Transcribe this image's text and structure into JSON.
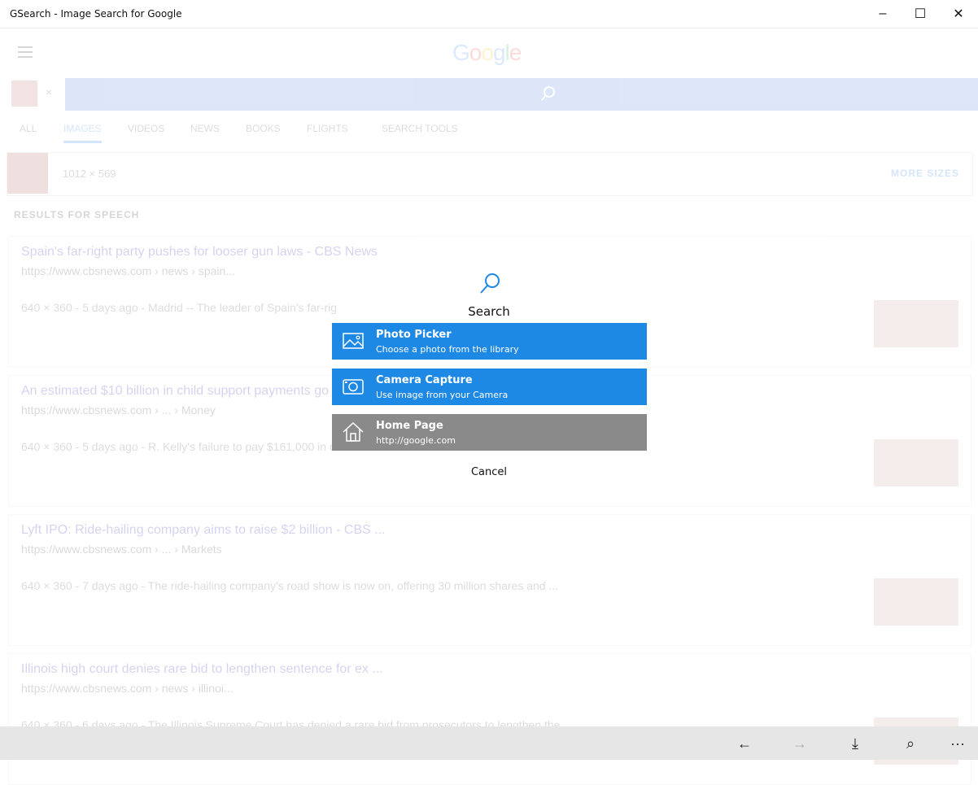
{
  "window": {
    "title": "GSearch - Image Search for Google",
    "min": "–",
    "max": "☐",
    "close": "✕"
  },
  "app": {
    "logo": {
      "G": "G",
      "o1": "o",
      "o2": "o",
      "g": "g",
      "l": "l",
      "e": "e"
    },
    "search_chip_close": "×",
    "tabs": [
      "ALL",
      "IMAGES",
      "VIDEOS",
      "NEWS",
      "BOOKS",
      "FLIGHTS",
      "SEARCH TOOLS"
    ],
    "active_tab": "IMAGES",
    "size_bar": {
      "dims": "1012 × 569",
      "more": "MORE SIZES"
    },
    "results_label": "RESULTS FOR SPEECH",
    "results": [
      {
        "title": "Spain's far-right party pushes for looser gun laws - CBS News",
        "url": "https://www.cbsnews.com › news › spain...",
        "desc": "640 × 360 - 5 days ago - Madrid -- The leader of Spain's far-rig"
      },
      {
        "title": "An estimated $10 billion in child support payments go",
        "url": "https://www.cbsnews.com › ... › Money",
        "desc": "640 × 360 - 5 days ago - R. Kelly's failure to pay $161,000 in c"
      },
      {
        "title": "Lyft IPO: Ride-hailing company aims to raise $2 billion - CBS ...",
        "url": "https://www.cbsnews.com › ... › Markets",
        "desc": "640 × 360 - 7 days ago - The ride-hailing company's road show is now on, offering 30 million shares and ..."
      },
      {
        "title": "Illinois high court denies rare bid to lengthen sentence for ex ...",
        "url": "https://www.cbsnews.com › news › illinoi...",
        "desc": "640 × 360 - 6 days ago - The Illinois Supreme Court has denied a rare bid from prosecutors to lengthen the ..."
      }
    ]
  },
  "dialog": {
    "title": "Search",
    "icon": "search-icon",
    "options": [
      {
        "title": "Photo Picker",
        "subtitle": "Choose a photo from the library",
        "icon": "image-icon",
        "color": "#1e88e5"
      },
      {
        "title": "Camera Capture",
        "subtitle": "Use image from your Camera",
        "icon": "camera-icon",
        "color": "#1e88e5"
      },
      {
        "title": "Home Page",
        "subtitle": "http://google.com",
        "icon": "home-icon",
        "color": "#8a8a8a"
      }
    ],
    "cancel": "Cancel"
  },
  "bottombar": {
    "back": "←",
    "forward": "→",
    "download": "⤓",
    "search": "⌕",
    "more": "···"
  }
}
